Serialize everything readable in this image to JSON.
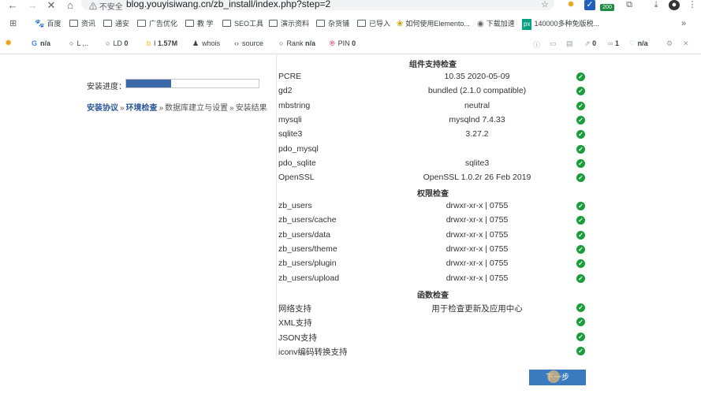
{
  "browser": {
    "security_label": "不安全",
    "url": "blog.youyisiwang.cn/zb_install/index.php?step=2",
    "extension_badge": "200"
  },
  "bookmarks": [
    "百度",
    "资讯",
    "通安",
    "广告优化",
    "教 学",
    "SEO工具",
    "演示资料",
    "杂货铺",
    "已导入",
    "如何使用Elemento...",
    "下载加速",
    "140000多种免版税..."
  ],
  "seo_toolbar": {
    "g_label": "G",
    "g_value": "n/a",
    "l_label": "L",
    "l_value": ",..",
    "ld_label": "LD",
    "ld_value": "0",
    "i_label": "I",
    "i_value": "1.57M",
    "whois": "whois",
    "source": "source",
    "rank_label": "Rank",
    "rank_value": "n/a",
    "pin_label": "PIN",
    "pin_value": "0",
    "r1": "0",
    "r2": "1",
    "r3": "n/a"
  },
  "install": {
    "progress_label": "安装进度：",
    "progress_fraction": 0.34,
    "steps": [
      "安装协议",
      "环境检查",
      "数据库建立与设置",
      "安装结果"
    ],
    "sections": [
      {
        "title": "组件支持检查",
        "rows": [
          {
            "name": "PCRE",
            "value": "10.35 2020-05-09"
          },
          {
            "name": "gd2",
            "value": "bundled (2.1.0 compatible)"
          },
          {
            "name": "mbstring",
            "value": "neutral"
          },
          {
            "name": "mysqli",
            "value": "mysqlnd 7.4.33"
          },
          {
            "name": "sqlite3",
            "value": "3.27.2"
          },
          {
            "name": "pdo_mysql",
            "value": ""
          },
          {
            "name": "pdo_sqlite",
            "value": "sqlite3"
          },
          {
            "name": "OpenSSL",
            "value": "OpenSSL 1.0.2r 26 Feb 2019"
          }
        ]
      },
      {
        "title": "权限检查",
        "rows": [
          {
            "name": "zb_users",
            "value": "drwxr-xr-x | 0755"
          },
          {
            "name": "zb_users/cache",
            "value": "drwxr-xr-x | 0755"
          },
          {
            "name": "zb_users/data",
            "value": "drwxr-xr-x | 0755"
          },
          {
            "name": "zb_users/theme",
            "value": "drwxr-xr-x | 0755"
          },
          {
            "name": "zb_users/plugin",
            "value": "drwxr-xr-x | 0755"
          },
          {
            "name": "zb_users/upload",
            "value": "drwxr-xr-x | 0755"
          }
        ]
      },
      {
        "title": "函数检查",
        "rows": [
          {
            "name": "网络支持",
            "value": "用于检查更新及应用中心"
          },
          {
            "name": "XML支持",
            "value": ""
          },
          {
            "name": "JSON支持",
            "value": ""
          },
          {
            "name": "iconv编码转换支持",
            "value": ""
          }
        ]
      }
    ],
    "check_mark": "✓",
    "next_button": "下一步"
  }
}
